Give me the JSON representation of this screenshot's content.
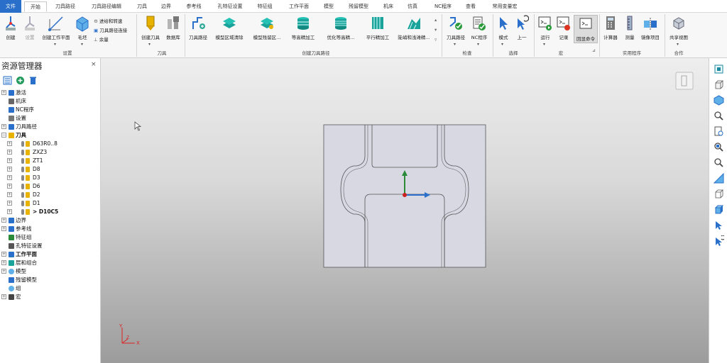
{
  "menu": {
    "tabs": [
      "文件",
      "开始",
      "刀具路径",
      "刀具路径编辑",
      "刀具",
      "边界",
      "参考线",
      "孔特征设置",
      "特征组",
      "工作平面",
      "模型",
      "残留模型",
      "机床",
      "仿真",
      "NC程序",
      "查看",
      "常用变量宏"
    ]
  },
  "ribbon": {
    "setup": {
      "create": "创建",
      "settings": "设置",
      "create_workplane": "创建工作平面",
      "blank": "毛坯",
      "feeds_speeds": "进给和转速",
      "toolpath_connections": "刀具路径连接",
      "allowance": "余量",
      "group": "设置"
    },
    "tool": {
      "create_tool": "创建刀具",
      "database": "数据库",
      "group": "刀具"
    },
    "create_toolpath": {
      "toolpath": "刀具路径",
      "model_area_clear": "模型区域清除",
      "model_rest_area": "模型残留区...",
      "constant_z": "等高精加工",
      "optimized_constant_z": "优化等高精...",
      "raster": "平行精加工",
      "steep_shallow": "陡峭和浅滩精...",
      "group": "创建刀具路径"
    },
    "check": {
      "toolpath": "刀具路径",
      "nc_program": "NC程序",
      "group": "检查"
    },
    "select": {
      "mode": "模式",
      "previous": "上一",
      "group": "选择"
    },
    "macro": {
      "run": "运行",
      "record": "记录",
      "echo": "回显命令",
      "group": "宏"
    },
    "utilities": {
      "calculator": "计算器",
      "measure": "测量",
      "mirror": "镜像项目",
      "group": "实用程序"
    },
    "collab": {
      "share_view": "共享视图",
      "group": "合作"
    }
  },
  "explorer": {
    "title": "资源管理器",
    "close": "×",
    "items": [
      {
        "label": "激活",
        "level": 0,
        "exp": "+",
        "icon": "active",
        "bold": false
      },
      {
        "label": "机床",
        "level": 0,
        "exp": "",
        "icon": "machine",
        "bold": false
      },
      {
        "label": "NC程序",
        "level": 0,
        "exp": "",
        "icon": "nc",
        "bold": false
      },
      {
        "label": "设置",
        "level": 0,
        "exp": "",
        "icon": "setup",
        "bold": false
      },
      {
        "label": "刀具路径",
        "level": 0,
        "exp": "+",
        "icon": "toolpath",
        "bold": false
      },
      {
        "label": "刀具",
        "level": 0,
        "exp": "-",
        "icon": "folder",
        "bold": true
      },
      {
        "label": "D63R0..8",
        "level": 1,
        "exp": "+",
        "icon": "tool",
        "bold": false
      },
      {
        "label": "ZXZ3",
        "level": 1,
        "exp": "+",
        "icon": "tool",
        "bold": false
      },
      {
        "label": "ZT1",
        "level": 1,
        "exp": "+",
        "icon": "tool",
        "bold": false
      },
      {
        "label": "D8",
        "level": 1,
        "exp": "+",
        "icon": "tool",
        "bold": false
      },
      {
        "label": "D3",
        "level": 1,
        "exp": "+",
        "icon": "tool",
        "bold": false
      },
      {
        "label": "D6",
        "level": 1,
        "exp": "+",
        "icon": "tool",
        "bold": false
      },
      {
        "label": "D2",
        "level": 1,
        "exp": "+",
        "icon": "tool",
        "bold": false
      },
      {
        "label": "D1",
        "level": 1,
        "exp": "+",
        "icon": "tool",
        "bold": false
      },
      {
        "label": "> D10C5",
        "level": 1,
        "exp": "+",
        "icon": "tool",
        "bold": true
      },
      {
        "label": "边界",
        "level": 0,
        "exp": "+",
        "icon": "boundary",
        "bold": false
      },
      {
        "label": "参考线",
        "level": 0,
        "exp": "+",
        "icon": "pattern",
        "bold": false
      },
      {
        "label": "特征组",
        "level": 0,
        "exp": "",
        "icon": "feature",
        "bold": false
      },
      {
        "label": "孔特征设置",
        "level": 0,
        "exp": "",
        "icon": "hole",
        "bold": false
      },
      {
        "label": "工作平面",
        "level": 0,
        "exp": "+",
        "icon": "workplane",
        "bold": true
      },
      {
        "label": "层和组合",
        "level": 0,
        "exp": "+",
        "icon": "layer",
        "bold": false
      },
      {
        "label": "模型",
        "level": 0,
        "exp": "+",
        "icon": "model",
        "bold": false
      },
      {
        "label": "残留模型",
        "level": 0,
        "exp": "",
        "icon": "stock",
        "bold": false
      },
      {
        "label": "组",
        "level": 0,
        "exp": "",
        "icon": "group",
        "bold": false
      },
      {
        "label": "宏",
        "level": 0,
        "exp": "+",
        "icon": "macro",
        "bold": false
      }
    ]
  },
  "viewport": {
    "axis_x": "X",
    "axis_y": "Y",
    "axis_z": "Z"
  },
  "colors": {
    "file_tab": "#2a6fc9",
    "accent": "#1f77c9",
    "model_face": "#d7d8e2"
  }
}
